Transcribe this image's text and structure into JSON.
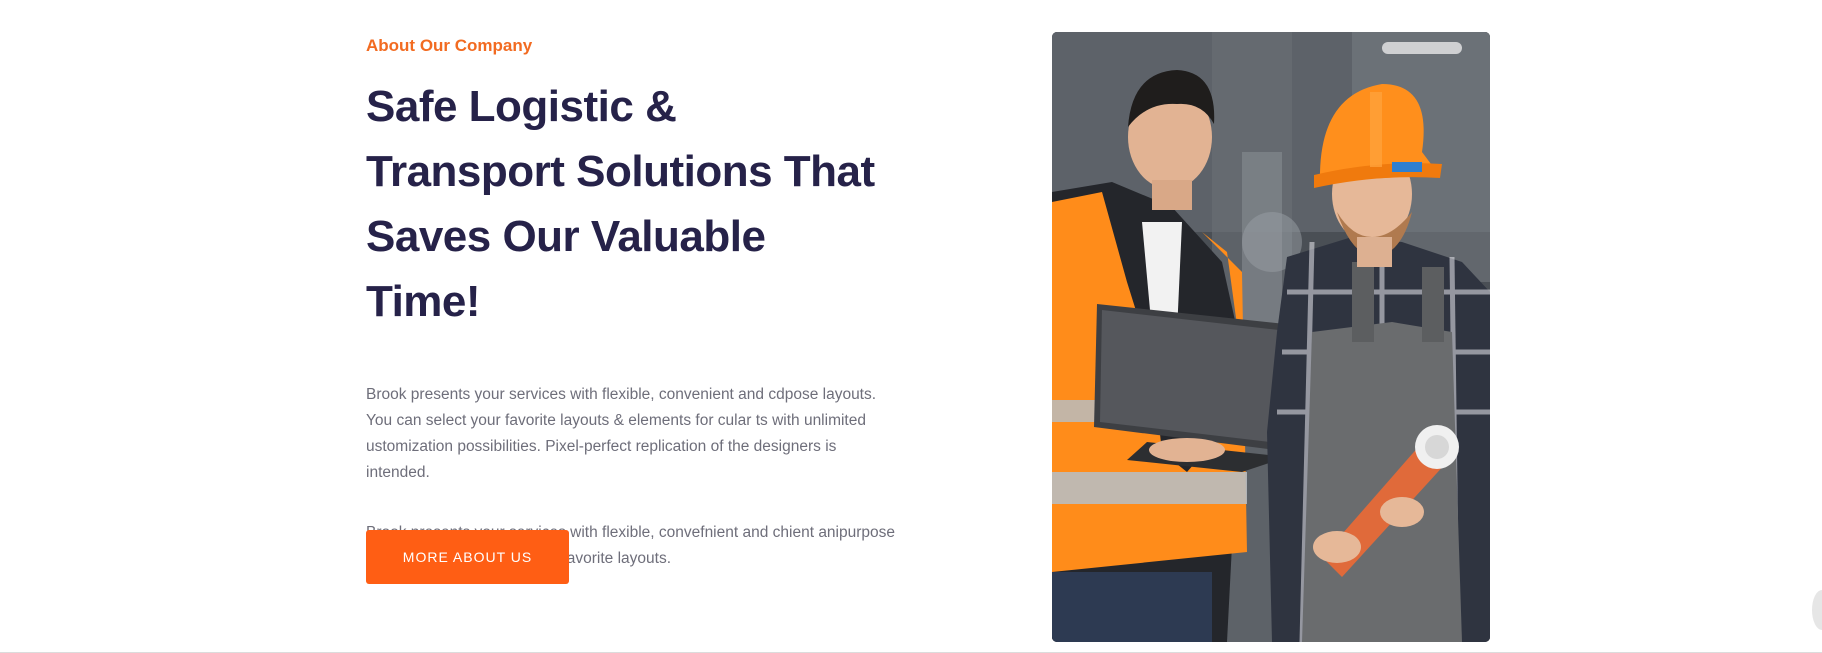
{
  "about": {
    "eyebrow": "About Our Company",
    "headline": "Safe Logistic & Transport Solutions That Saves Our Valuable Time!",
    "paragraph_1": "Brook presents your services with flexible, convenient and cdpose layouts. You can select your favorite layouts & elements for cular ts with unlimited ustomization possibilities. Pixel-perfect replication of the designers is intended.",
    "paragraph_2": "Brook presents your services with flexible, convefnient and chient anipurpose layouts. You can select your favorite layouts.",
    "cta_label": "MORE ABOUT US"
  },
  "colors": {
    "accent": "#ff5e14",
    "eyebrow": "#f26b21",
    "heading": "#262249",
    "body_text": "#6e6e7a"
  }
}
